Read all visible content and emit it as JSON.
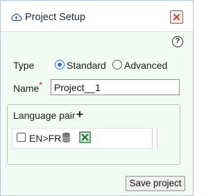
{
  "dialog": {
    "title": "Project Setup",
    "title_icon": "cloud-icon",
    "close_icon": "close-icon",
    "help_icon": "question-icon",
    "help_glyph": "?"
  },
  "form": {
    "type_label": "Type",
    "type_options": [
      {
        "label": "Standard",
        "selected": true
      },
      {
        "label": "Advanced",
        "selected": false
      }
    ],
    "name_label": "Name",
    "required_mark": "*",
    "name_value": "Project__1"
  },
  "language_pair": {
    "title": "Language pair",
    "add_glyph": "+",
    "items": [
      {
        "label": "EN>FR",
        "checked": false,
        "db_icon": "database-icon",
        "status_icon": "excel-file-icon"
      }
    ]
  },
  "footer": {
    "save_label": "Save project"
  },
  "colors": {
    "close_border": "#c6452f",
    "radio_accent": "#1a73e8",
    "required": "#d0312d",
    "panel_bg": "#f2fbf3"
  }
}
